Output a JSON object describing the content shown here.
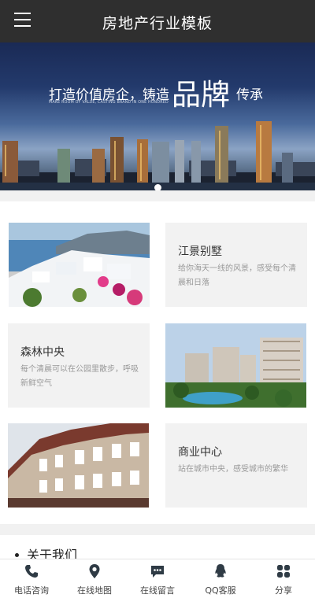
{
  "header": {
    "title": "房地产行业模板"
  },
  "banner": {
    "line_a": "打造价值房企，铸造",
    "line_b": "品牌",
    "line_c": "传承",
    "subtitle": "MAKE ROOM OF VALUE, CASTING BRAND IN ONE HUNDRED"
  },
  "cards": [
    {
      "title": "江景别墅",
      "desc": "给你海天一线的风景，感受每个清晨和日落"
    },
    {
      "title": "森林中央",
      "desc": "每个清晨可以在公园里散步，呼吸新鲜空气"
    },
    {
      "title": "商业中心",
      "desc": "站在城市中央，感受城市的繁华"
    }
  ],
  "about": {
    "label": "关于我们"
  },
  "footer": {
    "items": [
      {
        "label": "电话咨询",
        "icon": "phone-icon"
      },
      {
        "label": "在线地图",
        "icon": "map-pin-icon"
      },
      {
        "label": "在线留言",
        "icon": "chat-icon"
      },
      {
        "label": "QQ客服",
        "icon": "qq-icon"
      },
      {
        "label": "分享",
        "icon": "share-icon"
      }
    ]
  },
  "colors": {
    "header_bg": "#2f2f2f",
    "text_dark": "#333333",
    "text_muted": "#999999"
  }
}
